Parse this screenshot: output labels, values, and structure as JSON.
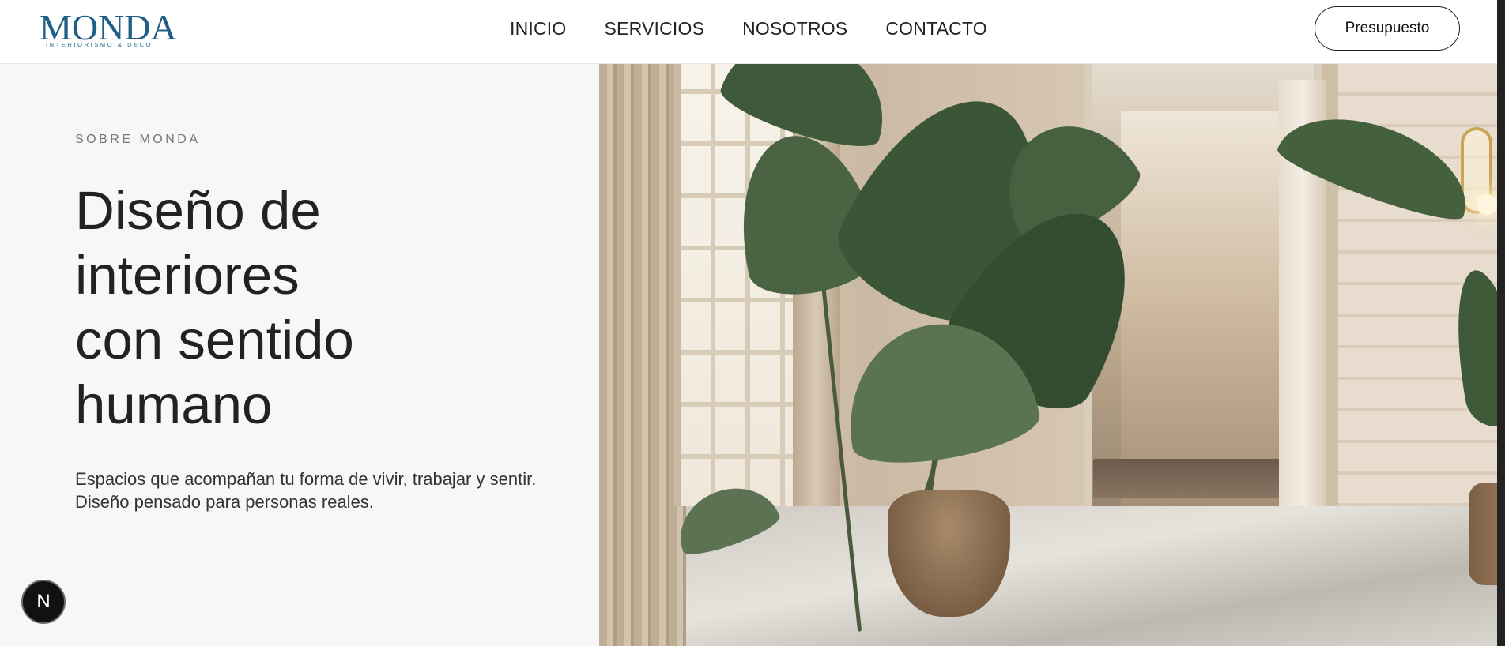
{
  "header": {
    "logo": {
      "word": "MONDA",
      "tagline": "INTERIORISMO & DECO"
    },
    "nav": [
      {
        "label": "INICIO"
      },
      {
        "label": "SERVICIOS"
      },
      {
        "label": "NOSOTROS"
      },
      {
        "label": "CONTACTO"
      }
    ],
    "cta_label": "Presupuesto"
  },
  "hero": {
    "eyebrow": "SOBRE MONDA",
    "headline_lines": [
      "Diseño de",
      "interiores",
      "con sentido",
      "humano"
    ],
    "lead": "Espacios que acompañan tu forma de vivir, trabajar y sentir. Diseño pensado para personas reales."
  },
  "floating_badge": {
    "letter": "N"
  },
  "colors": {
    "brand_blue": "#1f5f86",
    "page_bg": "#f7f7f7",
    "text": "#222222"
  }
}
